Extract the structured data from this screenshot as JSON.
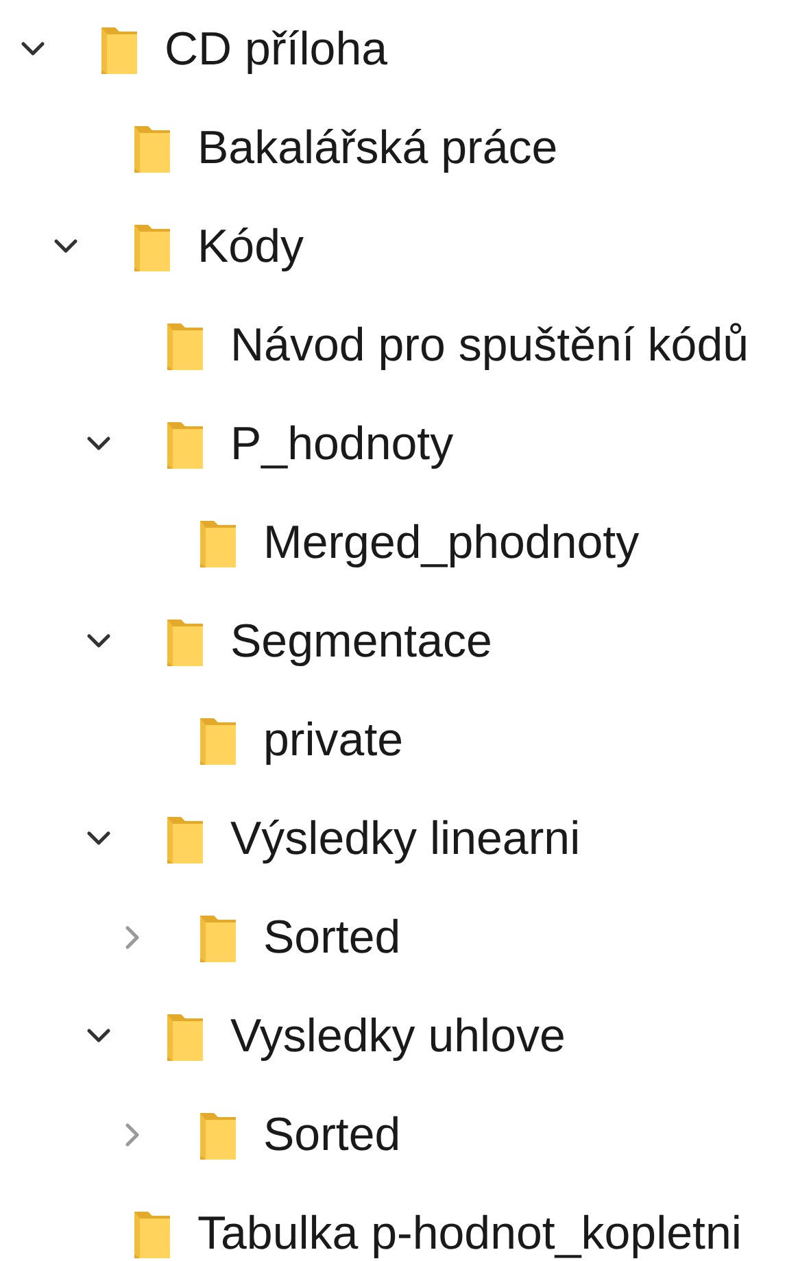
{
  "tree": [
    {
      "label": "CD příloha",
      "expanded": true,
      "children": [
        {
          "label": "Bakalářská práce"
        },
        {
          "label": "Kódy",
          "expanded": true,
          "children": [
            {
              "label": "Návod pro spuštění kódů"
            },
            {
              "label": "P_hodnoty",
              "expanded": true,
              "children": [
                {
                  "label": "Merged_phodnoty"
                }
              ]
            },
            {
              "label": "Segmentace",
              "expanded": true,
              "children": [
                {
                  "label": "private"
                }
              ]
            },
            {
              "label": "Výsledky linearni",
              "expanded": true,
              "children": [
                {
                  "label": "Sorted",
                  "expanded": false
                }
              ]
            },
            {
              "label": "Vysledky uhlove",
              "expanded": true,
              "children": [
                {
                  "label": "Sorted",
                  "expanded": false
                }
              ]
            }
          ]
        },
        {
          "label": "Tabulka p-hodnot_kopletni"
        }
      ]
    }
  ]
}
